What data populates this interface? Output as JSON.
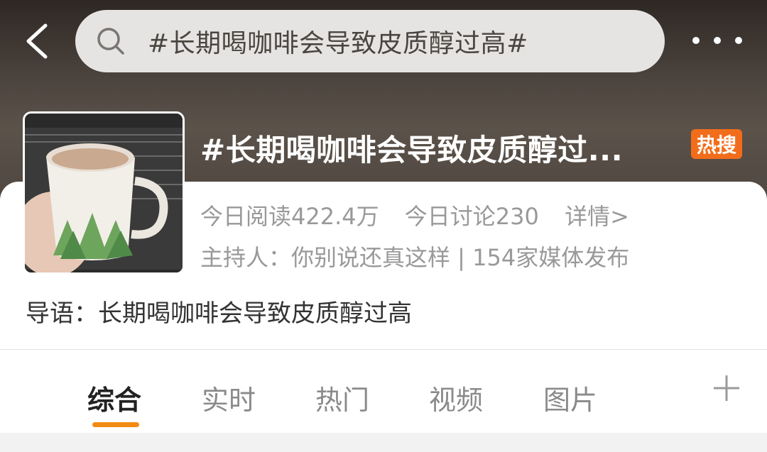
{
  "search": {
    "query": "#长期喝咖啡会导致皮质醇过高#"
  },
  "topic": {
    "title": "#长期喝咖啡会导致皮质醇过...",
    "badge": "热搜",
    "reads": "今日阅读422.4万",
    "discussions": "今日讨论230",
    "details": "详情>",
    "host": "主持人：你别说还真这样 | 154家媒体发布",
    "intro": "导语：长期喝咖啡会导致皮质醇过高"
  },
  "tabs": [
    {
      "label": "综合",
      "active": true
    },
    {
      "label": "实时",
      "active": false
    },
    {
      "label": "热门",
      "active": false
    },
    {
      "label": "视频",
      "active": false
    },
    {
      "label": "图片",
      "active": false
    }
  ],
  "colors": {
    "accent": "#f28a14",
    "hot_badge": "#f26d1b"
  },
  "icons": [
    "back-icon",
    "search-icon",
    "more-icon",
    "plus-icon"
  ]
}
